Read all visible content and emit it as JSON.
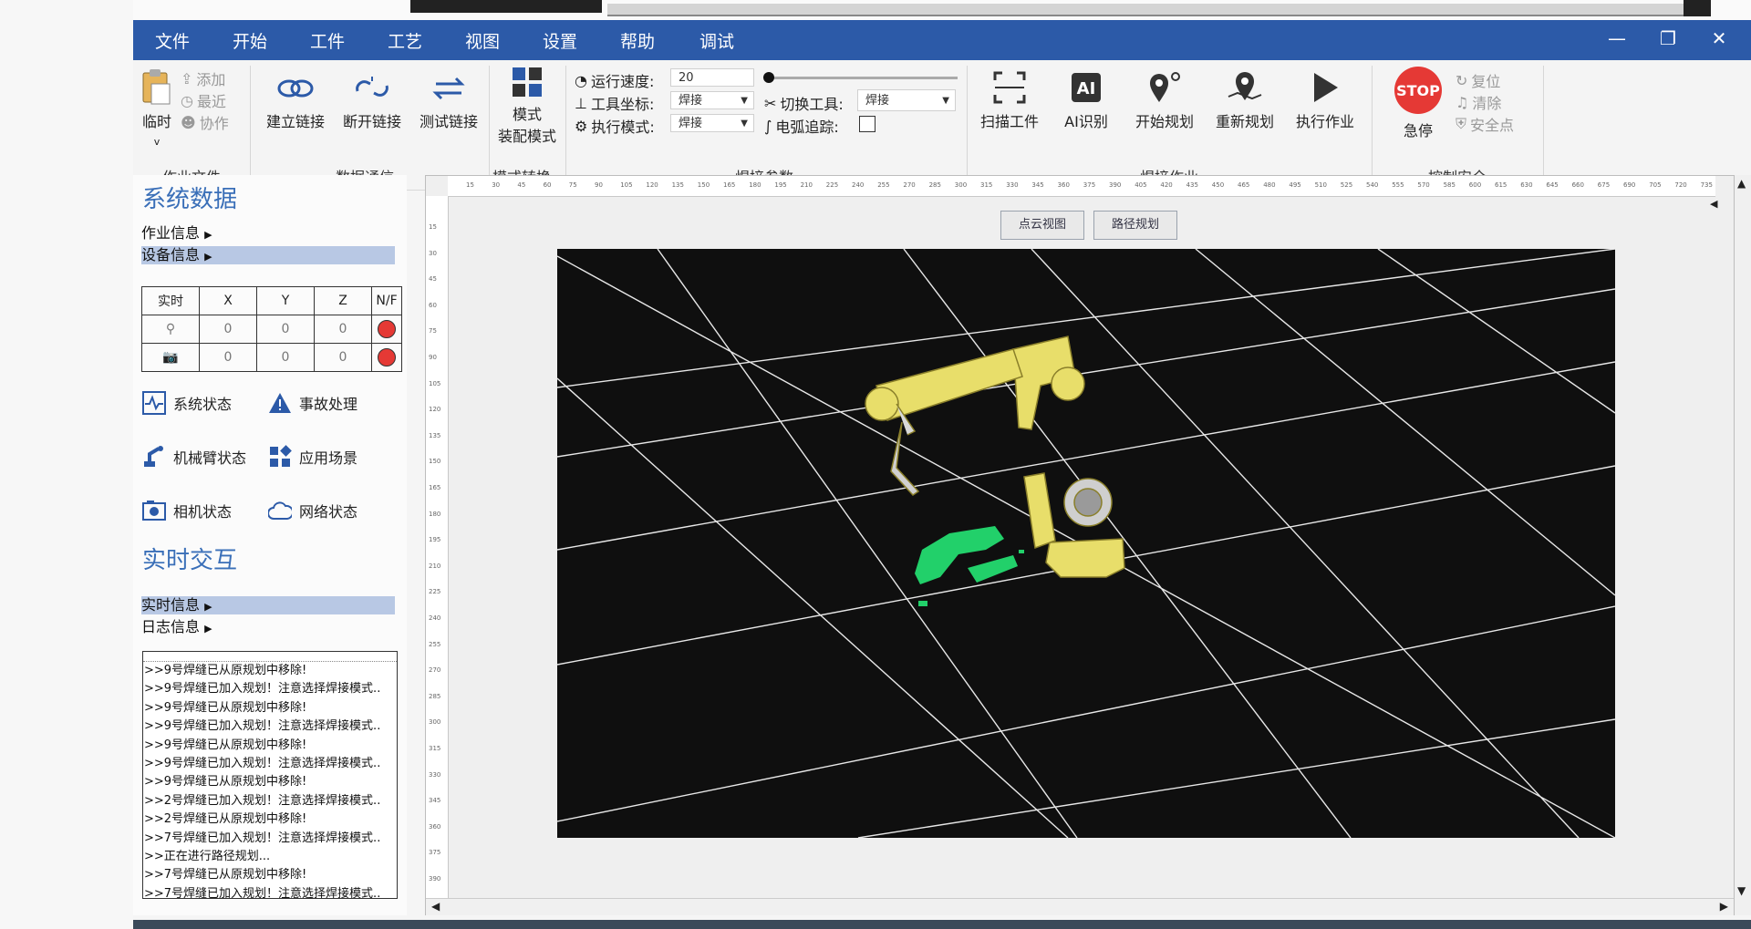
{
  "menu": [
    "文件",
    "开始",
    "工件",
    "工艺",
    "视图",
    "设置",
    "帮助",
    "调试"
  ],
  "ribbon": {
    "job_file": {
      "temp_label": "临时",
      "add": "添加",
      "recent": "最近",
      "collab": "协作",
      "group": "作业文件"
    },
    "data_comm": {
      "connect": "建立链接",
      "disconnect": "断开链接",
      "test": "测试链接",
      "group": "数据通信"
    },
    "mode_switch": {
      "btn_line1": "模式",
      "btn_line2": "装配模式",
      "group": "模式转换"
    },
    "weld_params": {
      "speed_label": "运行速度:",
      "speed_value": "20",
      "tool_coord_label": "工具坐标:",
      "tool_coord_value": "焊接",
      "exec_mode_label": "执行模式:",
      "exec_mode_value": "焊接",
      "switch_tool_label": "切换工具:",
      "switch_tool_value": "焊接",
      "arc_track_label": "电弧追踪:",
      "group": "焊接参数"
    },
    "weld_job": {
      "scan": "扫描工件",
      "ai": "AI识别",
      "plan": "开始规划",
      "replan": "重新规划",
      "exec": "执行作业",
      "group": "焊接作业"
    },
    "safety": {
      "stop_text": "STOP",
      "estop": "急停",
      "reset": "复位",
      "clear": "清除",
      "safe_point": "安全点",
      "group": "控制安全"
    }
  },
  "left": {
    "system_title": "系统数据",
    "job_info": "作业信息",
    "device_info": "设备信息",
    "table_headers": [
      "实时",
      "X",
      "Y",
      "Z",
      "N/F"
    ],
    "rows": [
      [
        "0",
        "0",
        "0"
      ],
      [
        "0",
        "0",
        "0"
      ]
    ],
    "status": {
      "system": "系统状态",
      "accident": "事故处理",
      "arm": "机械臂状态",
      "scene": "应用场景",
      "camera": "相机状态",
      "network": "网络状态"
    },
    "interact_title": "实时交互",
    "rt_info": "实时信息",
    "log_info": "日志信息",
    "logs": [
      ">>9号焊缝已从原规划中移除!",
      ">>9号焊缝已加入规划！注意选择焊接模式..",
      ">>9号焊缝已从原规划中移除!",
      ">>9号焊缝已加入规划！注意选择焊接模式..",
      ">>9号焊缝已从原规划中移除!",
      ">>9号焊缝已加入规划！注意选择焊接模式..",
      ">>9号焊缝已从原规划中移除!",
      ">>2号焊缝已加入规划！注意选择焊接模式..",
      ">>2号焊缝已从原规划中移除!",
      ">>7号焊缝已加入规划！注意选择焊接模式..",
      ">>正在进行路径规划...",
      ">>7号焊缝已从原规划中移除!",
      ">>7号焊缝已加入规划！注意选择焊接模式.."
    ]
  },
  "view": {
    "tab_cloud": "点云视图",
    "tab_path": "路径规划"
  },
  "ruler_top": [
    "15",
    "30",
    "45",
    "60",
    "75",
    "90",
    "105",
    "120",
    "135",
    "150",
    "165",
    "180",
    "195",
    "210",
    "225",
    "240",
    "255",
    "270",
    "285",
    "300",
    "315",
    "330",
    "345",
    "360",
    "375",
    "390",
    "405",
    "420",
    "435",
    "450",
    "465",
    "480",
    "495",
    "510",
    "525",
    "540",
    "555",
    "570",
    "585",
    "600",
    "615",
    "630",
    "645",
    "660",
    "675",
    "690",
    "705",
    "720",
    "735"
  ],
  "ruler_left": [
    "15",
    "30",
    "45",
    "60",
    "75",
    "90",
    "105",
    "120",
    "135",
    "150",
    "165",
    "180",
    "195",
    "210",
    "225",
    "240",
    "255",
    "270",
    "285",
    "300",
    "315",
    "330",
    "345",
    "360",
    "375",
    "390"
  ],
  "colors": {
    "title": "#2c5aa8",
    "accent": "#3a6fb8",
    "stop": "#e53935",
    "robot": "#e8de6a",
    "pointcloud": "#22d06a"
  }
}
